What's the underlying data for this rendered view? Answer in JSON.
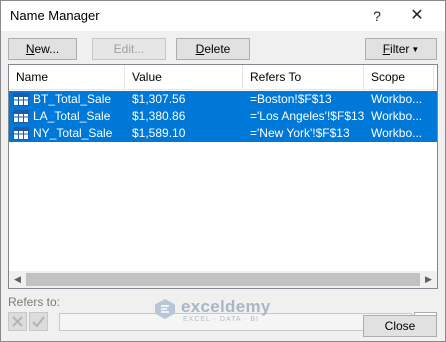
{
  "window": {
    "title": "Name Manager",
    "help_glyph": "?",
    "close_glyph": "✕"
  },
  "toolbar": {
    "new_prefix": "N",
    "new_rest": "ew...",
    "edit_label": "Edit...",
    "delete_prefix": "D",
    "delete_rest": "elete",
    "filter_prefix": "F",
    "filter_rest": "ilter",
    "filter_caret": "▼"
  },
  "table": {
    "columns": [
      "Name",
      "Value",
      "Refers To",
      "Scope"
    ],
    "rows": [
      {
        "name": "BT_Total_Sale",
        "value": "$1,307.56",
        "refers_to": "=Boston!$F$13",
        "scope": "Workbo..."
      },
      {
        "name": "LA_Total_Sale",
        "value": "$1,380.86",
        "refers_to": "='Los Angeles'!$F$13",
        "scope": "Workbo..."
      },
      {
        "name": "NY_Total_Sale",
        "value": "$1,589.10",
        "refers_to": "='New York'!$F$13",
        "scope": "Workbo..."
      }
    ],
    "selected_rows": [
      0,
      1,
      2
    ]
  },
  "refers_to": {
    "label": "Refers to:",
    "value": ""
  },
  "footer": {
    "close_label": "Close"
  },
  "watermark": {
    "name": "exceldemy",
    "tagline": "EXCEL · DATA · BI"
  },
  "colors": {
    "selection": "#0078d7",
    "dialog_bg": "#f0f0f0"
  },
  "icons": {
    "name_icon": "range-name-grid-icon",
    "scroll_left": "scroll-left-arrow-icon",
    "scroll_right": "scroll-right-arrow-icon",
    "cancel": "cancel-x-icon",
    "enter": "enter-check-icon",
    "collapse": "collapse-dialog-icon"
  }
}
